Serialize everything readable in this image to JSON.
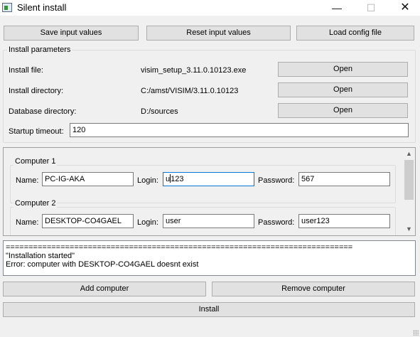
{
  "window": {
    "title": "Silent install",
    "minimize_glyph": "—",
    "maximize_glyph": "☐",
    "close_glyph": "✕",
    "icon": "app-window-icon"
  },
  "toolbar": {
    "save_label": "Save input values",
    "reset_label": "Reset input values",
    "load_label": "Load config file"
  },
  "install_params": {
    "title": "Install parameters",
    "file_label": "Install file:",
    "file_value": "visim_setup_3.11.0.10123.exe",
    "file_button": "Open",
    "dir_label": "Install directory:",
    "dir_value": "C:/amst/VISIM/3.11.0.10123",
    "dir_button": "Open",
    "db_label": "Database directory:",
    "db_value": "D:/sources",
    "db_button": "Open",
    "timeout_label": "Startup timeout:",
    "timeout_value": "120"
  },
  "computers": [
    {
      "title": "Computer 1",
      "name_label": "Name:",
      "name_value": "PC-IG-AKA",
      "login_label": "Login:",
      "login_before_caret": "u",
      "login_after_caret": "123",
      "password_label": "Password:",
      "password_value": "567"
    },
    {
      "title": "Computer 2",
      "name_label": "Name:",
      "name_value": "DESKTOP-CO4GAEL",
      "login_label": "Login:",
      "login_value": "user",
      "password_label": "Password:",
      "password_value": "user123"
    }
  ],
  "scrollbar": {
    "up_glyph": "▲",
    "down_glyph": "▼"
  },
  "log": {
    "lines": [
      "============================================================================",
      "\"Installation started\"",
      "Error: computer with DESKTOP-CO4GAEL doesnt exist"
    ]
  },
  "actions": {
    "add_label": "Add computer",
    "remove_label": "Remove computer",
    "install_label": "Install"
  }
}
